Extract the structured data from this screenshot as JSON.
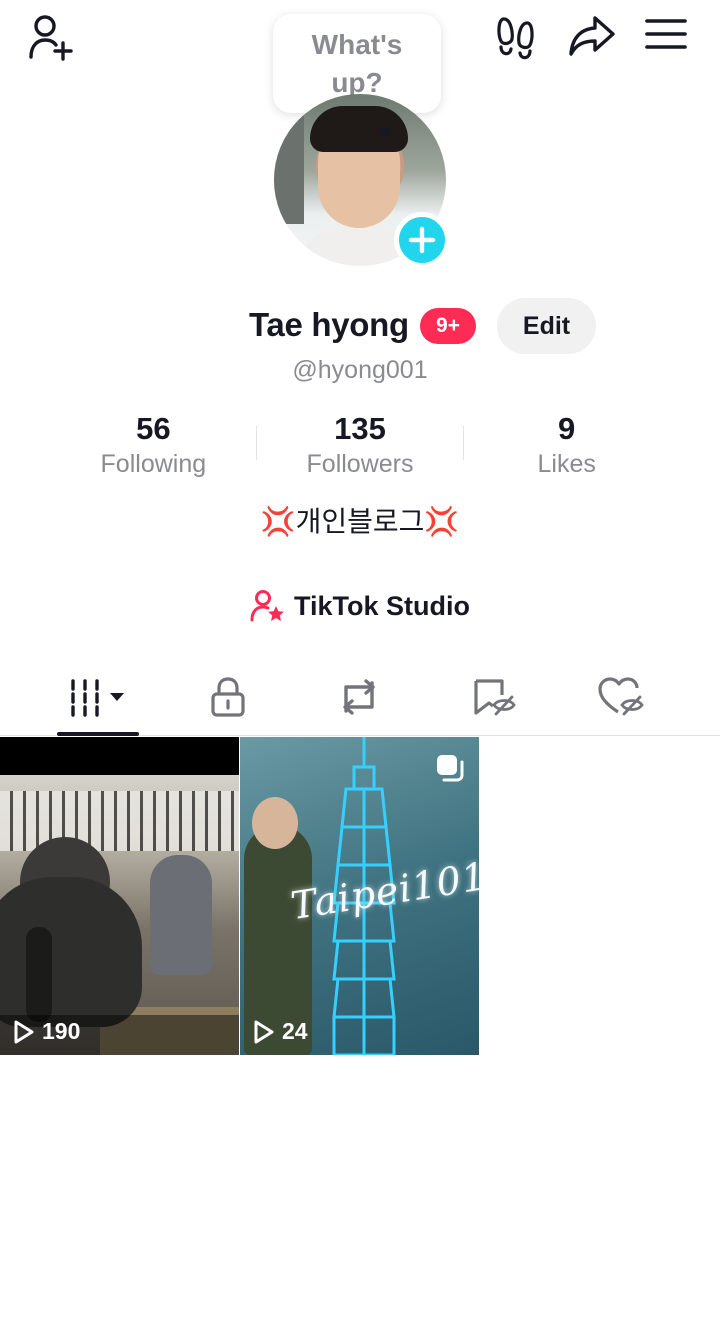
{
  "header": {
    "add_friend_icon": "person-plus-icon",
    "footprints_icon": "footprints-icon",
    "share_icon": "share-arrow-icon",
    "menu_icon": "hamburger-menu-icon"
  },
  "status_bubble": {
    "line1": "What's",
    "line2": "up?"
  },
  "profile": {
    "name": "Tae hyong",
    "notification_badge": "9+",
    "edit_label": "Edit",
    "handle": "@hyong001",
    "bio_prefix": "💢",
    "bio_text": "개인블로그",
    "bio_suffix": "💢"
  },
  "stats": [
    {
      "value": "56",
      "label": "Following"
    },
    {
      "value": "135",
      "label": "Followers"
    },
    {
      "value": "9",
      "label": "Likes"
    }
  ],
  "studio": {
    "label": "TikTok Studio",
    "icon": "person-star-icon"
  },
  "tabs": [
    {
      "name": "videos",
      "icon": "grid-videos-icon",
      "selected": true
    },
    {
      "name": "private",
      "icon": "lock-icon",
      "selected": false
    },
    {
      "name": "reposts",
      "icon": "repost-icon",
      "selected": false
    },
    {
      "name": "favorites",
      "icon": "bookmark-hidden-icon",
      "selected": false
    },
    {
      "name": "liked",
      "icon": "heart-hidden-icon",
      "selected": false
    }
  ],
  "videos": [
    {
      "views": "190",
      "icon": "play-icon"
    },
    {
      "views": "24",
      "icon": "play-icon",
      "overlay_text": "Taipei101",
      "multi_icon": "multi-photo-icon"
    }
  ],
  "colors": {
    "accent_red": "#fe2c55",
    "accent_cyan": "#20d5ec",
    "text_primary": "#161823",
    "text_secondary": "#8a8b91"
  }
}
